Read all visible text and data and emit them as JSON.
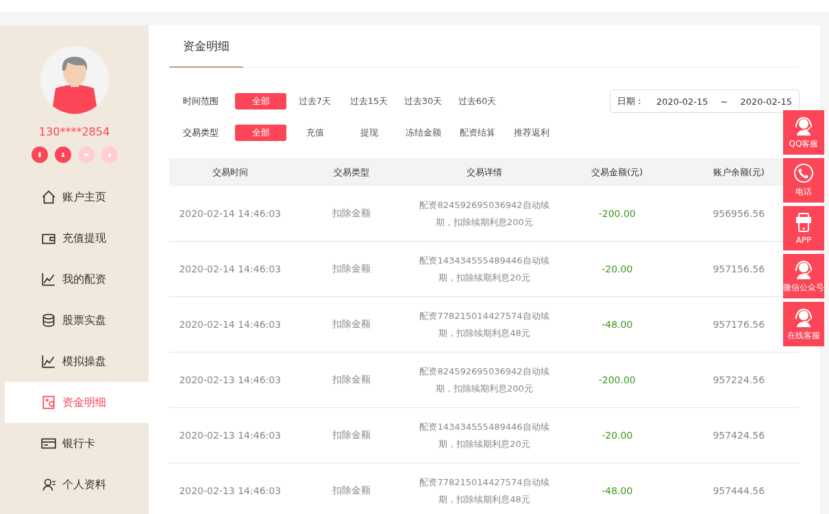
{
  "user": {
    "phone": "130****2854",
    "verifications": [
      {
        "on": true
      },
      {
        "on": true
      },
      {
        "on": false
      },
      {
        "on": false
      }
    ]
  },
  "sidebar": {
    "items": [
      {
        "label": "账户主页",
        "selected": false
      },
      {
        "label": "充值提现",
        "selected": false
      },
      {
        "label": "我的配资",
        "selected": false
      },
      {
        "label": "股票实盘",
        "selected": false
      },
      {
        "label": "模拟操盘",
        "selected": false
      },
      {
        "label": "资金明细",
        "selected": true
      },
      {
        "label": "银行卡",
        "selected": false
      },
      {
        "label": "个人资料",
        "selected": false
      }
    ]
  },
  "page_tab": {
    "label": "资金明细"
  },
  "filters": [
    {
      "label": "时间范围",
      "options": [
        {
          "label": "全部",
          "selected": true
        },
        {
          "label": "过去7天",
          "selected": false
        },
        {
          "label": "过去15天",
          "selected": false
        },
        {
          "label": "过去30天",
          "selected": false
        },
        {
          "label": "过去60天",
          "selected": false
        }
      ]
    },
    {
      "label": "交易类型",
      "options": [
        {
          "label": "全部",
          "selected": true
        },
        {
          "label": "充值",
          "selected": false
        },
        {
          "label": "提现",
          "selected": false
        },
        {
          "label": "冻结金额",
          "selected": false
        },
        {
          "label": "配资结算",
          "selected": false
        },
        {
          "label": "推荐返利",
          "selected": false
        }
      ]
    }
  ],
  "date_range": {
    "label": "日期：",
    "start": "2020-02-15",
    "separator": "~",
    "end": "2020-02-15"
  },
  "table": {
    "columns": [
      "交易时间",
      "交易类型",
      "交易详情",
      "交易金额(元)",
      "账户余额(元)"
    ],
    "rows": [
      [
        "2020-02-14 14:46:03",
        "扣除金额",
        "配资824592695036942自动续期，扣除续期利息200元",
        "-200.00",
        "956956.56"
      ],
      [
        "2020-02-14 14:46:03",
        "扣除金额",
        "配资143434555489446自动续期，扣除续期利息20元",
        "-20.00",
        "957156.56"
      ],
      [
        "2020-02-14 14:46:03",
        "扣除金额",
        "配资778215014427574自动续期，扣除续期利息48元",
        "-48.00",
        "957176.56"
      ],
      [
        "2020-02-13 14:46:03",
        "扣除金额",
        "配资824592695036942自动续期，扣除续期利息200元",
        "-200.00",
        "957224.56"
      ],
      [
        "2020-02-13 14:46:03",
        "扣除金额",
        "配资143434555489446自动续期，扣除续期利息20元",
        "-20.00",
        "957424.56"
      ],
      [
        "2020-02-13 14:46:03",
        "扣除金额",
        "配资778215014427574自动续期，扣除续期利息48元",
        "-48.00",
        "957444.56"
      ]
    ]
  },
  "service_bar": [
    {
      "label": "QQ客服"
    },
    {
      "label": "电话"
    },
    {
      "label": "APP"
    },
    {
      "label": "微信公众号"
    },
    {
      "label": "在线客服"
    }
  ]
}
